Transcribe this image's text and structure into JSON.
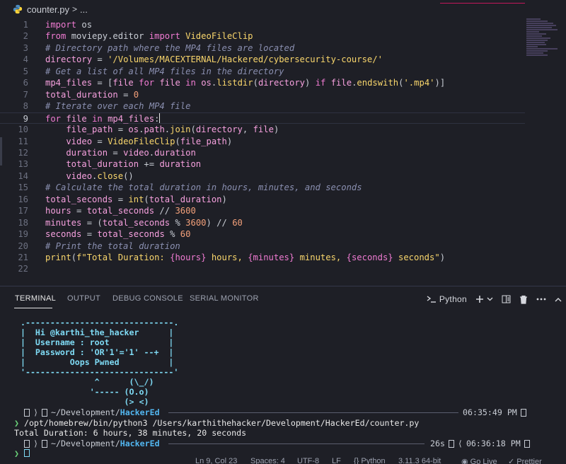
{
  "breadcrumb": {
    "file": "counter.py",
    "sep": ">",
    "more": "..."
  },
  "editor": {
    "active_line": 9,
    "lines": [
      {
        "n": "1"
      },
      {
        "n": "2"
      },
      {
        "n": "3"
      },
      {
        "n": "4"
      },
      {
        "n": "5"
      },
      {
        "n": "6"
      },
      {
        "n": "7"
      },
      {
        "n": "8"
      },
      {
        "n": "9"
      },
      {
        "n": "10"
      },
      {
        "n": "11"
      },
      {
        "n": "12"
      },
      {
        "n": "13"
      },
      {
        "n": "14"
      },
      {
        "n": "15"
      },
      {
        "n": "16"
      },
      {
        "n": "17"
      },
      {
        "n": "18"
      },
      {
        "n": "19"
      },
      {
        "n": "20"
      },
      {
        "n": "21"
      },
      {
        "n": "22"
      }
    ],
    "tokens": {
      "l1": [
        "import",
        " os"
      ],
      "l2": [
        "from",
        " moviepy.editor ",
        "import",
        " VideoFileClip"
      ],
      "l3": "# Directory path where the MP4 files are located",
      "l4": [
        "directory",
        " = ",
        "'/Volumes/MACEXTERNAL/Hackered/cybersecurity-course/'"
      ],
      "l5": "# Get a list of all MP4 files in the directory",
      "l6": [
        "mp4_files",
        " = [",
        "file",
        " ",
        "for",
        " ",
        "file",
        " ",
        "in",
        " ",
        "os",
        ".",
        "listdir",
        "(",
        "directory",
        ") ",
        "if",
        " ",
        "file",
        ".",
        "endswith",
        "(",
        "'.mp4'",
        ")]"
      ],
      "l7": [
        "total_duration",
        " = ",
        "0"
      ],
      "l8": "# Iterate over each MP4 file",
      "l9": [
        "for",
        " ",
        "file",
        " ",
        "in",
        " ",
        "mp4_files",
        ":"
      ],
      "l10": [
        "    file_path",
        " = ",
        "os",
        ".",
        "path",
        ".",
        "join",
        "(",
        "directory",
        ", ",
        "file",
        ")"
      ],
      "l11": [
        "    video",
        " = ",
        "VideoFileClip",
        "(",
        "file_path",
        ")"
      ],
      "l12": [
        "    duration",
        " = ",
        "video",
        ".",
        "duration"
      ],
      "l13": [
        "    total_duration",
        " += ",
        "duration"
      ],
      "l14": [
        "    video",
        ".",
        "close",
        "()"
      ],
      "l15": "# Calculate the total duration in hours, minutes, and seconds",
      "l16": [
        "total_seconds",
        " = ",
        "int",
        "(",
        "total_duration",
        ")"
      ],
      "l17": [
        "hours",
        " = ",
        "total_seconds",
        " // ",
        "3600"
      ],
      "l18": [
        "minutes",
        " = (",
        "total_seconds",
        " % ",
        "3600",
        ") // ",
        "60"
      ],
      "l19": [
        "seconds",
        " = ",
        "total_seconds",
        " % ",
        "60"
      ],
      "l20": "# Print the total duration",
      "l21": [
        "print",
        "(",
        "f\"Total Duration: ",
        "{hours}",
        " hours, ",
        "{minutes}",
        " minutes, ",
        "{seconds}",
        " seconds\"",
        ")"
      ]
    }
  },
  "panel": {
    "tabs": [
      "TERMINAL",
      "OUTPUT",
      "DEBUG CONSOLE",
      "SERIAL MONITOR"
    ],
    "shell_label": "Python"
  },
  "terminal": {
    "banner": [
      " .------------------------------.",
      " |  Hi @karthi_the_hacker      |",
      " |  Username : root            |",
      " |  Password : 'OR'1'='1' --+  |",
      " |         Oops Pwned          |",
      " '------------------------------'"
    ],
    "ascii_cow": [
      "                ^      (\\_/)",
      "               '----- (O.o)",
      "                      (> <)"
    ],
    "prompt1": {
      "path_prefix": "~/Development/",
      "path_hl": "HackerEd",
      "time": "06:35:49 PM"
    },
    "command": "/opt/homebrew/bin/python3 /Users/karthithehacker/Development/HackerEd/counter.py",
    "output": "Total Duration: 6 hours, 38 minutes, 20 seconds",
    "prompt2": {
      "path_prefix": "~/Development/",
      "path_hl": "HackerEd",
      "elapsed": "26s",
      "time": "06:36:18 PM"
    },
    "prompt_char": "❯"
  },
  "status": {
    "position": "Ln 9, Col 23",
    "spaces": "Spaces: 4",
    "encoding": "UTF-8",
    "eol": "LF",
    "language": "Python",
    "interpreter": "3.11.3 64-bit",
    "golive": "Go Live",
    "prettier": "Prettier"
  },
  "colors": {
    "background": "#1e1f26",
    "keyword": "#f07bd2",
    "string": "#f9d66c",
    "comment": "#8a8fb0",
    "terminal_cyan": "#7fdbf5",
    "path_blue": "#52b6f0",
    "prompt_green": "#6bd47a"
  }
}
